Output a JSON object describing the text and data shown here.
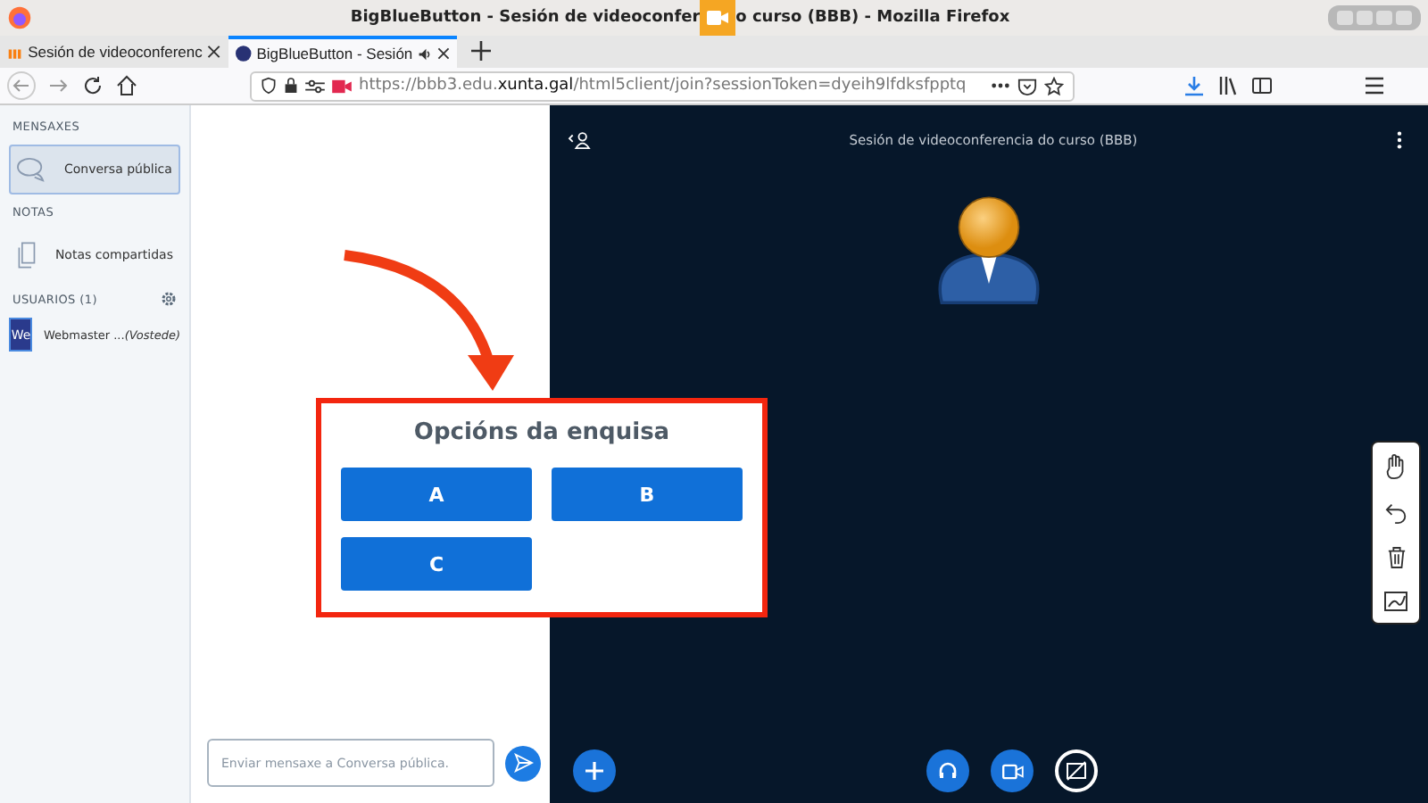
{
  "window": {
    "title_before": "BigBlueButton - Sesión de videoconfer",
    "title_after": "o curso (BBB) - Mozilla Firefox"
  },
  "tabs": [
    {
      "label": "Sesión de videoconferenc",
      "selected": false
    },
    {
      "label": "BigBlueButton - Sesión",
      "selected": true
    }
  ],
  "url": {
    "scheme_host": "https://bbb3.edu.",
    "domain": "xunta.gal",
    "path": "/html5client/join?sessionToken=dyeih9lfdksfpptq"
  },
  "sidebar": {
    "messages_heading": "MENSAXES",
    "chat_item": {
      "label": "Conversa pública",
      "selected": true
    },
    "notes_heading": "NOTAS",
    "notes_item": "Notas compartidas",
    "users_heading": "USUARIOS (1)",
    "user": {
      "avatar": "We",
      "name": "Webmaster ...",
      "suffix": "(Vostede)"
    }
  },
  "chat": {
    "placeholder": "Enviar mensaxe a Conversa pública."
  },
  "presentation": {
    "title": "Sesión de videoconferencia do curso (BBB)"
  },
  "poll": {
    "title": "Opcións da enquisa",
    "options": [
      "A",
      "B",
      "C"
    ]
  }
}
